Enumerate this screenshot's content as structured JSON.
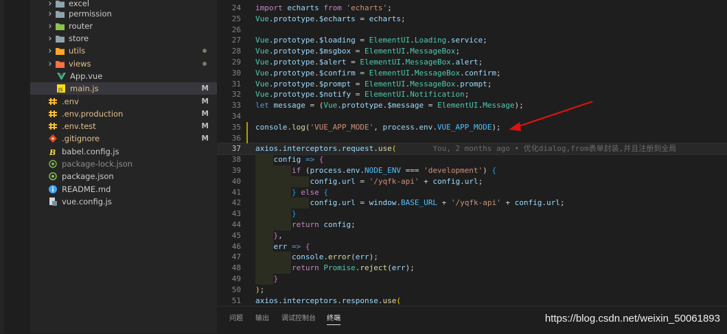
{
  "explorer": {
    "items": [
      {
        "name": "excel",
        "kind": "folder",
        "expanded": false,
        "icon": "folder-icon",
        "badge": "",
        "dot": false
      },
      {
        "name": "permission",
        "kind": "folder",
        "expanded": false,
        "icon": "folder-icon",
        "badge": "",
        "dot": false
      },
      {
        "name": "router",
        "kind": "folder",
        "expanded": false,
        "icon": "router-folder-icon",
        "badge": "",
        "dot": false
      },
      {
        "name": "store",
        "kind": "folder",
        "expanded": false,
        "icon": "folder-icon",
        "badge": "",
        "dot": false
      },
      {
        "name": "utils",
        "kind": "folder",
        "expanded": false,
        "icon": "utils-folder-icon",
        "badge": "",
        "dot": true
      },
      {
        "name": "views",
        "kind": "folder",
        "expanded": false,
        "icon": "views-folder-icon",
        "badge": "",
        "dot": true
      },
      {
        "name": "App.vue",
        "kind": "file",
        "icon": "vue-file-icon",
        "badge": "",
        "dot": false
      },
      {
        "name": "main.js",
        "kind": "file",
        "icon": "js-file-icon",
        "badge": "M",
        "dot": false,
        "selected": true
      },
      {
        "name": ".env",
        "kind": "file",
        "icon": "env-file-icon",
        "badge": "M",
        "dot": false
      },
      {
        "name": ".env.production",
        "kind": "file",
        "icon": "env-file-icon",
        "badge": "M",
        "dot": false
      },
      {
        "name": ".env.test",
        "kind": "file",
        "icon": "env-file-icon",
        "badge": "M",
        "dot": false
      },
      {
        "name": ".gitignore",
        "kind": "file",
        "icon": "git-file-icon",
        "badge": "M",
        "dot": false
      },
      {
        "name": "babel.config.js",
        "kind": "file",
        "icon": "babel-file-icon",
        "badge": "",
        "dot": false
      },
      {
        "name": "package-lock.json",
        "kind": "file",
        "icon": "npm-lock-file-icon",
        "badge": "",
        "dot": false,
        "dim": true
      },
      {
        "name": "package.json",
        "kind": "file",
        "icon": "npm-file-icon",
        "badge": "",
        "dot": false
      },
      {
        "name": "README.md",
        "kind": "file",
        "icon": "info-file-icon",
        "badge": "",
        "dot": false
      },
      {
        "name": "vue.config.js",
        "kind": "file",
        "icon": "config-file-icon",
        "badge": "",
        "dot": false
      }
    ]
  },
  "editor": {
    "file": "main.js",
    "current_line": 37,
    "lines": [
      {
        "n": "24",
        "tokens": [
          [
            "k",
            "import"
          ],
          [
            "v",
            " echarts "
          ],
          [
            "k",
            "from"
          ],
          [
            "s",
            " 'echarts'"
          ],
          [
            "p",
            ";"
          ]
        ]
      },
      {
        "n": "25",
        "tokens": [
          [
            "t",
            "Vue"
          ],
          [
            "p",
            "."
          ],
          [
            "v",
            "prototype"
          ],
          [
            "p",
            "."
          ],
          [
            "v",
            "$echarts"
          ],
          [
            "p",
            " = "
          ],
          [
            "v",
            "echarts"
          ],
          [
            "p",
            ";"
          ]
        ]
      },
      {
        "n": "26",
        "tokens": []
      },
      {
        "n": "27",
        "tokens": [
          [
            "t",
            "Vue"
          ],
          [
            "p",
            "."
          ],
          [
            "v",
            "prototype"
          ],
          [
            "p",
            "."
          ],
          [
            "v",
            "$loading"
          ],
          [
            "p",
            " = "
          ],
          [
            "t",
            "ElementUI"
          ],
          [
            "p",
            "."
          ],
          [
            "t",
            "Loading"
          ],
          [
            "p",
            "."
          ],
          [
            "v",
            "service"
          ],
          [
            "p",
            ";"
          ]
        ]
      },
      {
        "n": "28",
        "tokens": [
          [
            "t",
            "Vue"
          ],
          [
            "p",
            "."
          ],
          [
            "v",
            "prototype"
          ],
          [
            "p",
            "."
          ],
          [
            "v",
            "$msgbox"
          ],
          [
            "p",
            " = "
          ],
          [
            "t",
            "ElementUI"
          ],
          [
            "p",
            "."
          ],
          [
            "t",
            "MessageBox"
          ],
          [
            "p",
            ";"
          ]
        ]
      },
      {
        "n": "29",
        "tokens": [
          [
            "t",
            "Vue"
          ],
          [
            "p",
            "."
          ],
          [
            "v",
            "prototype"
          ],
          [
            "p",
            "."
          ],
          [
            "v",
            "$alert"
          ],
          [
            "p",
            " = "
          ],
          [
            "t",
            "ElementUI"
          ],
          [
            "p",
            "."
          ],
          [
            "t",
            "MessageBox"
          ],
          [
            "p",
            "."
          ],
          [
            "v",
            "alert"
          ],
          [
            "p",
            ";"
          ]
        ]
      },
      {
        "n": "30",
        "tokens": [
          [
            "t",
            "Vue"
          ],
          [
            "p",
            "."
          ],
          [
            "v",
            "prototype"
          ],
          [
            "p",
            "."
          ],
          [
            "v",
            "$confirm"
          ],
          [
            "p",
            " = "
          ],
          [
            "t",
            "ElementUI"
          ],
          [
            "p",
            "."
          ],
          [
            "t",
            "MessageBox"
          ],
          [
            "p",
            "."
          ],
          [
            "v",
            "confirm"
          ],
          [
            "p",
            ";"
          ]
        ]
      },
      {
        "n": "31",
        "tokens": [
          [
            "t",
            "Vue"
          ],
          [
            "p",
            "."
          ],
          [
            "v",
            "prototype"
          ],
          [
            "p",
            "."
          ],
          [
            "v",
            "$prompt"
          ],
          [
            "p",
            " = "
          ],
          [
            "t",
            "ElementUI"
          ],
          [
            "p",
            "."
          ],
          [
            "t",
            "MessageBox"
          ],
          [
            "p",
            "."
          ],
          [
            "v",
            "prompt"
          ],
          [
            "p",
            ";"
          ]
        ]
      },
      {
        "n": "32",
        "tokens": [
          [
            "t",
            "Vue"
          ],
          [
            "p",
            "."
          ],
          [
            "v",
            "prototype"
          ],
          [
            "p",
            "."
          ],
          [
            "v",
            "$notify"
          ],
          [
            "p",
            " = "
          ],
          [
            "t",
            "ElementUI"
          ],
          [
            "p",
            "."
          ],
          [
            "t",
            "Notification"
          ],
          [
            "p",
            ";"
          ]
        ]
      },
      {
        "n": "33",
        "tokens": [
          [
            "kw",
            "let"
          ],
          [
            "v",
            " message"
          ],
          [
            "p",
            " = ("
          ],
          [
            "t",
            "Vue"
          ],
          [
            "p",
            "."
          ],
          [
            "v",
            "prototype"
          ],
          [
            "p",
            "."
          ],
          [
            "v",
            "$message"
          ],
          [
            "p",
            " = "
          ],
          [
            "t",
            "ElementUI"
          ],
          [
            "p",
            "."
          ],
          [
            "t",
            "Message"
          ],
          [
            "p",
            ");"
          ]
        ]
      },
      {
        "n": "34",
        "tokens": []
      },
      {
        "n": "35",
        "tokens": [
          [
            "v",
            "console"
          ],
          [
            "p",
            "."
          ],
          [
            "f",
            "log"
          ],
          [
            "p",
            "("
          ],
          [
            "s",
            "'VUE_APP_MODE'"
          ],
          [
            "p",
            ", "
          ],
          [
            "v",
            "process"
          ],
          [
            "p",
            "."
          ],
          [
            "v",
            "env"
          ],
          [
            "p",
            "."
          ],
          [
            "c",
            "VUE_APP_MODE"
          ],
          [
            "p",
            ");"
          ]
        ]
      },
      {
        "n": "36",
        "tokens": []
      },
      {
        "n": "37",
        "tokens": [
          [
            "v",
            "axios"
          ],
          [
            "p",
            "."
          ],
          [
            "v",
            "interceptors"
          ],
          [
            "p",
            "."
          ],
          [
            "v",
            "request"
          ],
          [
            "p",
            "."
          ],
          [
            "f",
            "use"
          ],
          [
            "b",
            "("
          ],
          [
            "bl",
            "        You, 2 months ago • 优化dialog,from表单封装,并且注册到全局"
          ]
        ]
      },
      {
        "n": "38",
        "tokens": [
          [
            "p",
            "    "
          ],
          [
            "v",
            "config"
          ],
          [
            "kw2",
            " =>"
          ],
          [
            "p",
            " "
          ],
          [
            "b2",
            "{"
          ]
        ]
      },
      {
        "n": "39",
        "tokens": [
          [
            "p",
            "        "
          ],
          [
            "k",
            "if"
          ],
          [
            "p",
            " ("
          ],
          [
            "v",
            "process"
          ],
          [
            "p",
            "."
          ],
          [
            "v",
            "env"
          ],
          [
            "p",
            "."
          ],
          [
            "c",
            "NODE_ENV"
          ],
          [
            "p",
            " === "
          ],
          [
            "s",
            "'development'"
          ],
          [
            "p",
            ") "
          ],
          [
            "b3",
            "{"
          ]
        ]
      },
      {
        "n": "40",
        "tokens": [
          [
            "p",
            "            "
          ],
          [
            "v",
            "config"
          ],
          [
            "p",
            "."
          ],
          [
            "v",
            "url"
          ],
          [
            "p",
            " = "
          ],
          [
            "s",
            "'/yqfk-api'"
          ],
          [
            "p",
            " + "
          ],
          [
            "v",
            "config"
          ],
          [
            "p",
            "."
          ],
          [
            "v",
            "url"
          ],
          [
            "p",
            ";"
          ]
        ]
      },
      {
        "n": "41",
        "tokens": [
          [
            "p",
            "        "
          ],
          [
            "b3",
            "}"
          ],
          [
            "p",
            " "
          ],
          [
            "k",
            "else"
          ],
          [
            "p",
            " "
          ],
          [
            "b3",
            "{"
          ]
        ]
      },
      {
        "n": "42",
        "tokens": [
          [
            "p",
            "            "
          ],
          [
            "v",
            "config"
          ],
          [
            "p",
            "."
          ],
          [
            "v",
            "url"
          ],
          [
            "p",
            " = "
          ],
          [
            "v",
            "window"
          ],
          [
            "p",
            "."
          ],
          [
            "c",
            "BASE_URL"
          ],
          [
            "p",
            " + "
          ],
          [
            "s",
            "'/yqfk-api'"
          ],
          [
            "p",
            " + "
          ],
          [
            "v",
            "config"
          ],
          [
            "p",
            "."
          ],
          [
            "v",
            "url"
          ],
          [
            "p",
            ";"
          ]
        ]
      },
      {
        "n": "43",
        "tokens": [
          [
            "p",
            "        "
          ],
          [
            "b3",
            "}"
          ]
        ]
      },
      {
        "n": "44",
        "tokens": [
          [
            "p",
            "        "
          ],
          [
            "k",
            "return"
          ],
          [
            "v",
            " config"
          ],
          [
            "p",
            ";"
          ]
        ]
      },
      {
        "n": "45",
        "tokens": [
          [
            "p",
            "    "
          ],
          [
            "b2",
            "}"
          ],
          [
            "p",
            ","
          ]
        ]
      },
      {
        "n": "46",
        "tokens": [
          [
            "p",
            "    "
          ],
          [
            "v",
            "err"
          ],
          [
            "kw2",
            " =>"
          ],
          [
            "p",
            " "
          ],
          [
            "b2",
            "{"
          ]
        ]
      },
      {
        "n": "47",
        "tokens": [
          [
            "p",
            "        "
          ],
          [
            "v",
            "console"
          ],
          [
            "p",
            "."
          ],
          [
            "f",
            "error"
          ],
          [
            "p",
            "("
          ],
          [
            "v",
            "err"
          ],
          [
            "p",
            ");"
          ]
        ]
      },
      {
        "n": "48",
        "tokens": [
          [
            "p",
            "        "
          ],
          [
            "k",
            "return"
          ],
          [
            "p",
            " "
          ],
          [
            "t",
            "Promise"
          ],
          [
            "p",
            "."
          ],
          [
            "f",
            "reject"
          ],
          [
            "p",
            "("
          ],
          [
            "v",
            "err"
          ],
          [
            "p",
            ");"
          ]
        ]
      },
      {
        "n": "49",
        "tokens": [
          [
            "p",
            "    "
          ],
          [
            "b2",
            "}"
          ]
        ]
      },
      {
        "n": "50",
        "tokens": [
          [
            "b",
            ")"
          ],
          [
            "p",
            ";"
          ]
        ]
      },
      {
        "n": "51",
        "tokens": [
          [
            "v",
            "axios"
          ],
          [
            "p",
            "."
          ],
          [
            "v",
            "interceptors"
          ],
          [
            "p",
            "."
          ],
          [
            "v",
            "response"
          ],
          [
            "p",
            "."
          ],
          [
            "f",
            "use"
          ],
          [
            "b",
            "("
          ]
        ]
      }
    ]
  },
  "panel": {
    "tabs": [
      {
        "label": "问题",
        "active": false
      },
      {
        "label": "输出",
        "active": false
      },
      {
        "label": "调试控制台",
        "active": false
      },
      {
        "label": "终端",
        "active": true
      }
    ]
  },
  "watermark": "https://blog.csdn.net/weixin_50061893",
  "colors": {
    "annotation_arrow": "#e01010",
    "background": "#1e1e1e",
    "sidebar": "#252526"
  }
}
